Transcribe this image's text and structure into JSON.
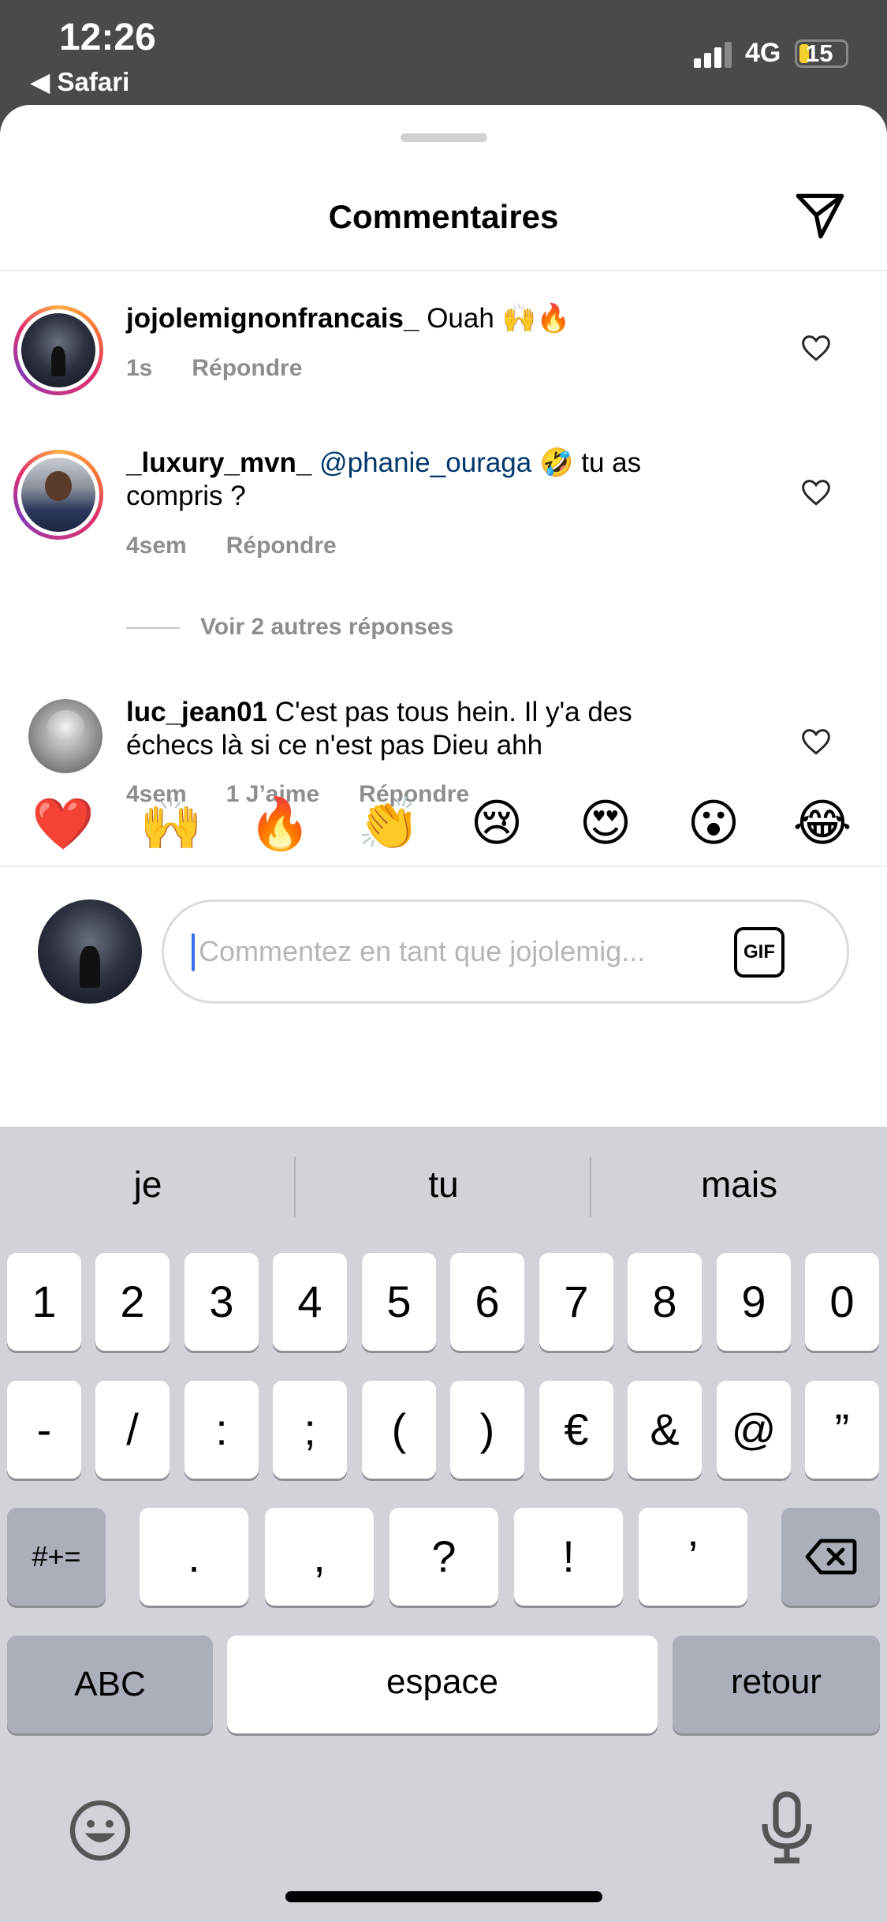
{
  "status_bar": {
    "time": "12:26",
    "back_app": "◀ Safari",
    "network": "4G",
    "battery": "15"
  },
  "header": {
    "title": "Commentaires",
    "share_icon": "send-icon"
  },
  "comments": [
    {
      "username": "jojolemignonfrancais_",
      "text": " Ouah 🙌🔥",
      "time": "1s",
      "likes": "",
      "reply_label": "Répondre"
    },
    {
      "username": "_luxury_mvn_",
      "mention": "@phanie_ouraga",
      "text": " 🤣 tu as compris ?",
      "time": "4sem",
      "likes": "",
      "reply_label": "Répondre"
    },
    {
      "username": "luc_jean01",
      "text": " C'est pas tous hein. Il y'a des échecs là si ce n'est pas Dieu ahh",
      "time": "4sem",
      "likes": "1 J’aime",
      "reply_label": "Répondre"
    }
  ],
  "more_replies": "Voir 2 autres réponses",
  "emoji_bar": [
    "❤️",
    "🙌",
    "🔥",
    "👏",
    "😢",
    "😍",
    "😮",
    "😂"
  ],
  "composer": {
    "placeholder": "Commentez en tant que jojolemig...",
    "gif_label": "GIF"
  },
  "keyboard": {
    "suggestions": [
      "je",
      "tu",
      "mais"
    ],
    "row1": [
      "1",
      "2",
      "3",
      "4",
      "5",
      "6",
      "7",
      "8",
      "9",
      "0"
    ],
    "row2": [
      "-",
      "/",
      ":",
      ";",
      "(",
      ")",
      "€",
      "&",
      "@",
      "”"
    ],
    "row3_left": "#+=",
    "row3": [
      ".",
      ",",
      "?",
      "!",
      "’"
    ],
    "abc": "ABC",
    "space": "espace",
    "return": "retour"
  },
  "colors": {
    "mention": "#00376b",
    "meta": "#8e8e8e",
    "keyboard_bg": "#d1d3d9",
    "caret": "#3b6cf4"
  }
}
